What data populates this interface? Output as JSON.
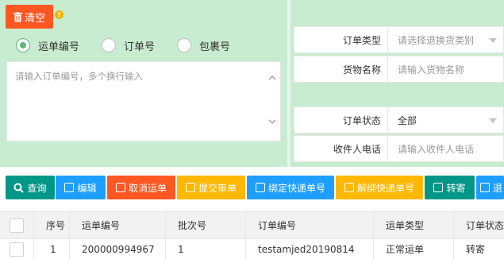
{
  "actions": {
    "clear_label": "清空",
    "help": "?"
  },
  "search_type": {
    "options": [
      "运单编号",
      "订单号",
      "包裹号"
    ],
    "selected": "运单编号"
  },
  "input_box": {
    "placeholder": "请输入订单编号，多个换行输入"
  },
  "form": {
    "order_type": {
      "label": "订单类型",
      "value": "请选择退换货类别"
    },
    "goods_name": {
      "label": "货物名称",
      "value": "请输入货物名称"
    },
    "order_status": {
      "label": "订单状态",
      "value": "全部"
    },
    "receiver_phone": {
      "label": "收件人电话",
      "value": "请输入收件人电话"
    }
  },
  "toolbar": {
    "query": "查询",
    "edit": "编辑",
    "cancel_waybill": "取消运单",
    "submit_review": "提交审单",
    "bind_express": "绑定快递单号",
    "unbind_express": "解绑快递单号",
    "transfer": "转寄",
    "more": "退"
  },
  "table": {
    "columns": [
      "序号",
      "运单编号",
      "批次号",
      "订单编号",
      "运单类型",
      "订单状态"
    ],
    "rows": [
      {
        "index": "1",
        "waybill_no": "200000994967",
        "batch_no": "1",
        "order_no": "testamjed20190814",
        "waybill_type": "正常运单",
        "order_status": "转寄"
      }
    ]
  },
  "colors": {
    "primary_green": "#5fb878",
    "teal": "#009688",
    "blue": "#1e9fff",
    "red": "#ff5722",
    "orange": "#ffb800",
    "panel_bg": "#c8ecd0"
  }
}
